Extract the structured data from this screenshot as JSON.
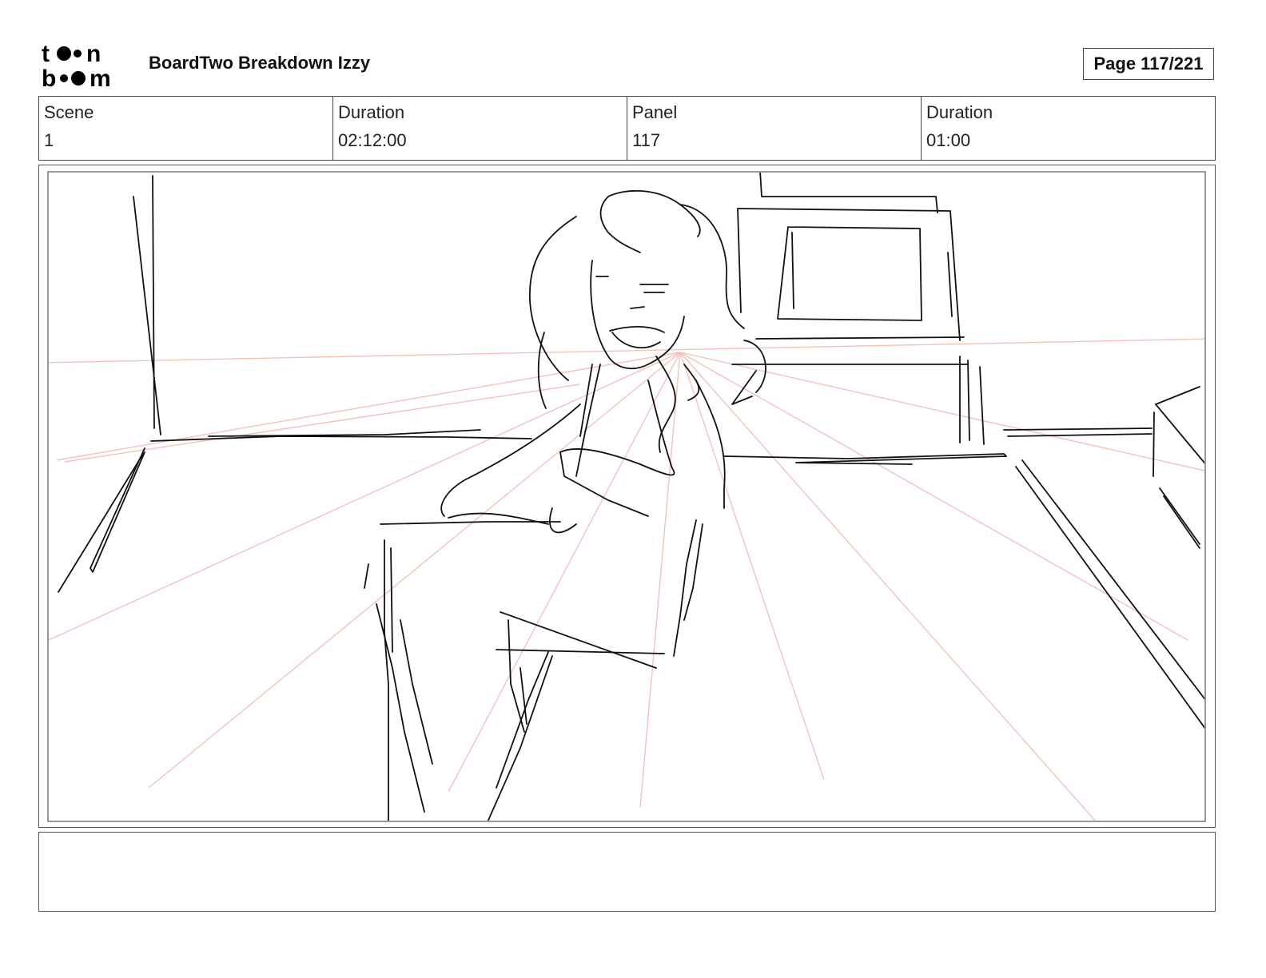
{
  "header": {
    "logo_text": "toon boom",
    "title": "BoardTwo Breakdown Izzy",
    "page_indicator": "Page 117/221"
  },
  "info": {
    "scene_label": "Scene",
    "scene_value": "1",
    "scene_duration_label": "Duration",
    "scene_duration_value": "02:12:00",
    "panel_label": "Panel",
    "panel_value": "117",
    "panel_duration_label": "Duration",
    "panel_duration_value": "01:00"
  },
  "notes": {
    "text": ""
  },
  "colors": {
    "sketch_line": "#111111",
    "perspective_guide": "#f0b8ae"
  }
}
